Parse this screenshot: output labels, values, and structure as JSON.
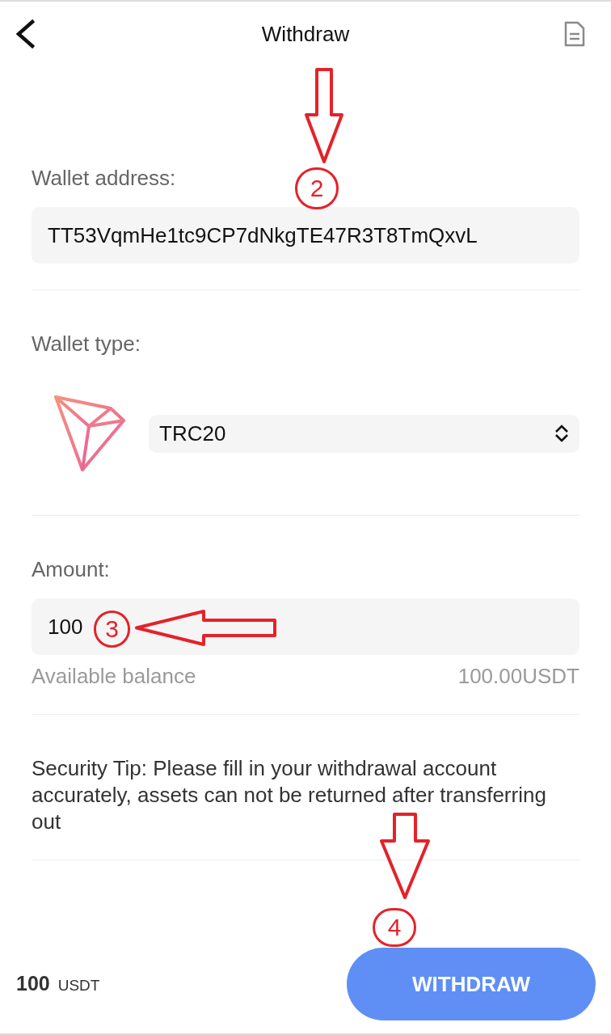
{
  "header": {
    "title": "Withdraw"
  },
  "wallet_address": {
    "label": "Wallet address:",
    "value": "TT53VqmHe1tc9CP7dNkgTE47R3T8TmQxvL"
  },
  "wallet_type": {
    "label": "Wallet type:",
    "value": "TRC20"
  },
  "amount": {
    "label": "Amount:",
    "value": "100",
    "balance_label": "Available balance",
    "balance_value": "100.00USDT"
  },
  "security_tip": "Security Tip: Please fill in your withdrawal account accurately, assets can not be returned after transferring out",
  "footer": {
    "amount": "100",
    "unit": "USDT",
    "button": "WITHDRAW"
  },
  "annotations": [
    {
      "number": "2",
      "kind": "down"
    },
    {
      "number": "3",
      "kind": "left"
    },
    {
      "number": "4",
      "kind": "down"
    }
  ]
}
